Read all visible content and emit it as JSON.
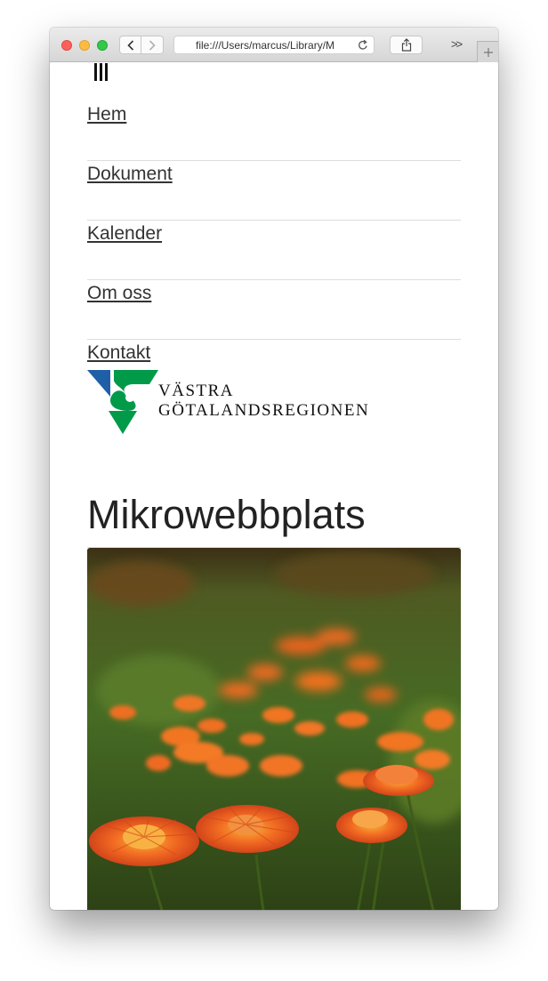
{
  "browser": {
    "url": "file:///Users/marcus/Library/M",
    "overflow_label": ">>",
    "icons": {
      "back": "chevron-left-icon",
      "forward": "chevron-right-icon",
      "reload": "reload-icon",
      "share": "share-icon",
      "new_tab": "plus-icon"
    }
  },
  "site": {
    "menu_icon": "hamburger-menu-icon",
    "nav": [
      {
        "label": "Hem"
      },
      {
        "label": "Dokument"
      },
      {
        "label": "Kalender"
      },
      {
        "label": "Om oss"
      },
      {
        "label": "Kontakt"
      }
    ],
    "logo": {
      "line1": "VÄSTRA",
      "line2": "GÖTALANDSREGIONEN",
      "colors": {
        "blue": "#1f5fa8",
        "green": "#009a49"
      }
    },
    "page_title": "Mikrowebbplats",
    "hero_image": "orange-marigold-flowers-photo"
  },
  "colors": {
    "text": "#333333",
    "divider": "#dddddd",
    "close": "#fc605c",
    "minimize": "#fdbc40",
    "maximize": "#34c84a"
  }
}
